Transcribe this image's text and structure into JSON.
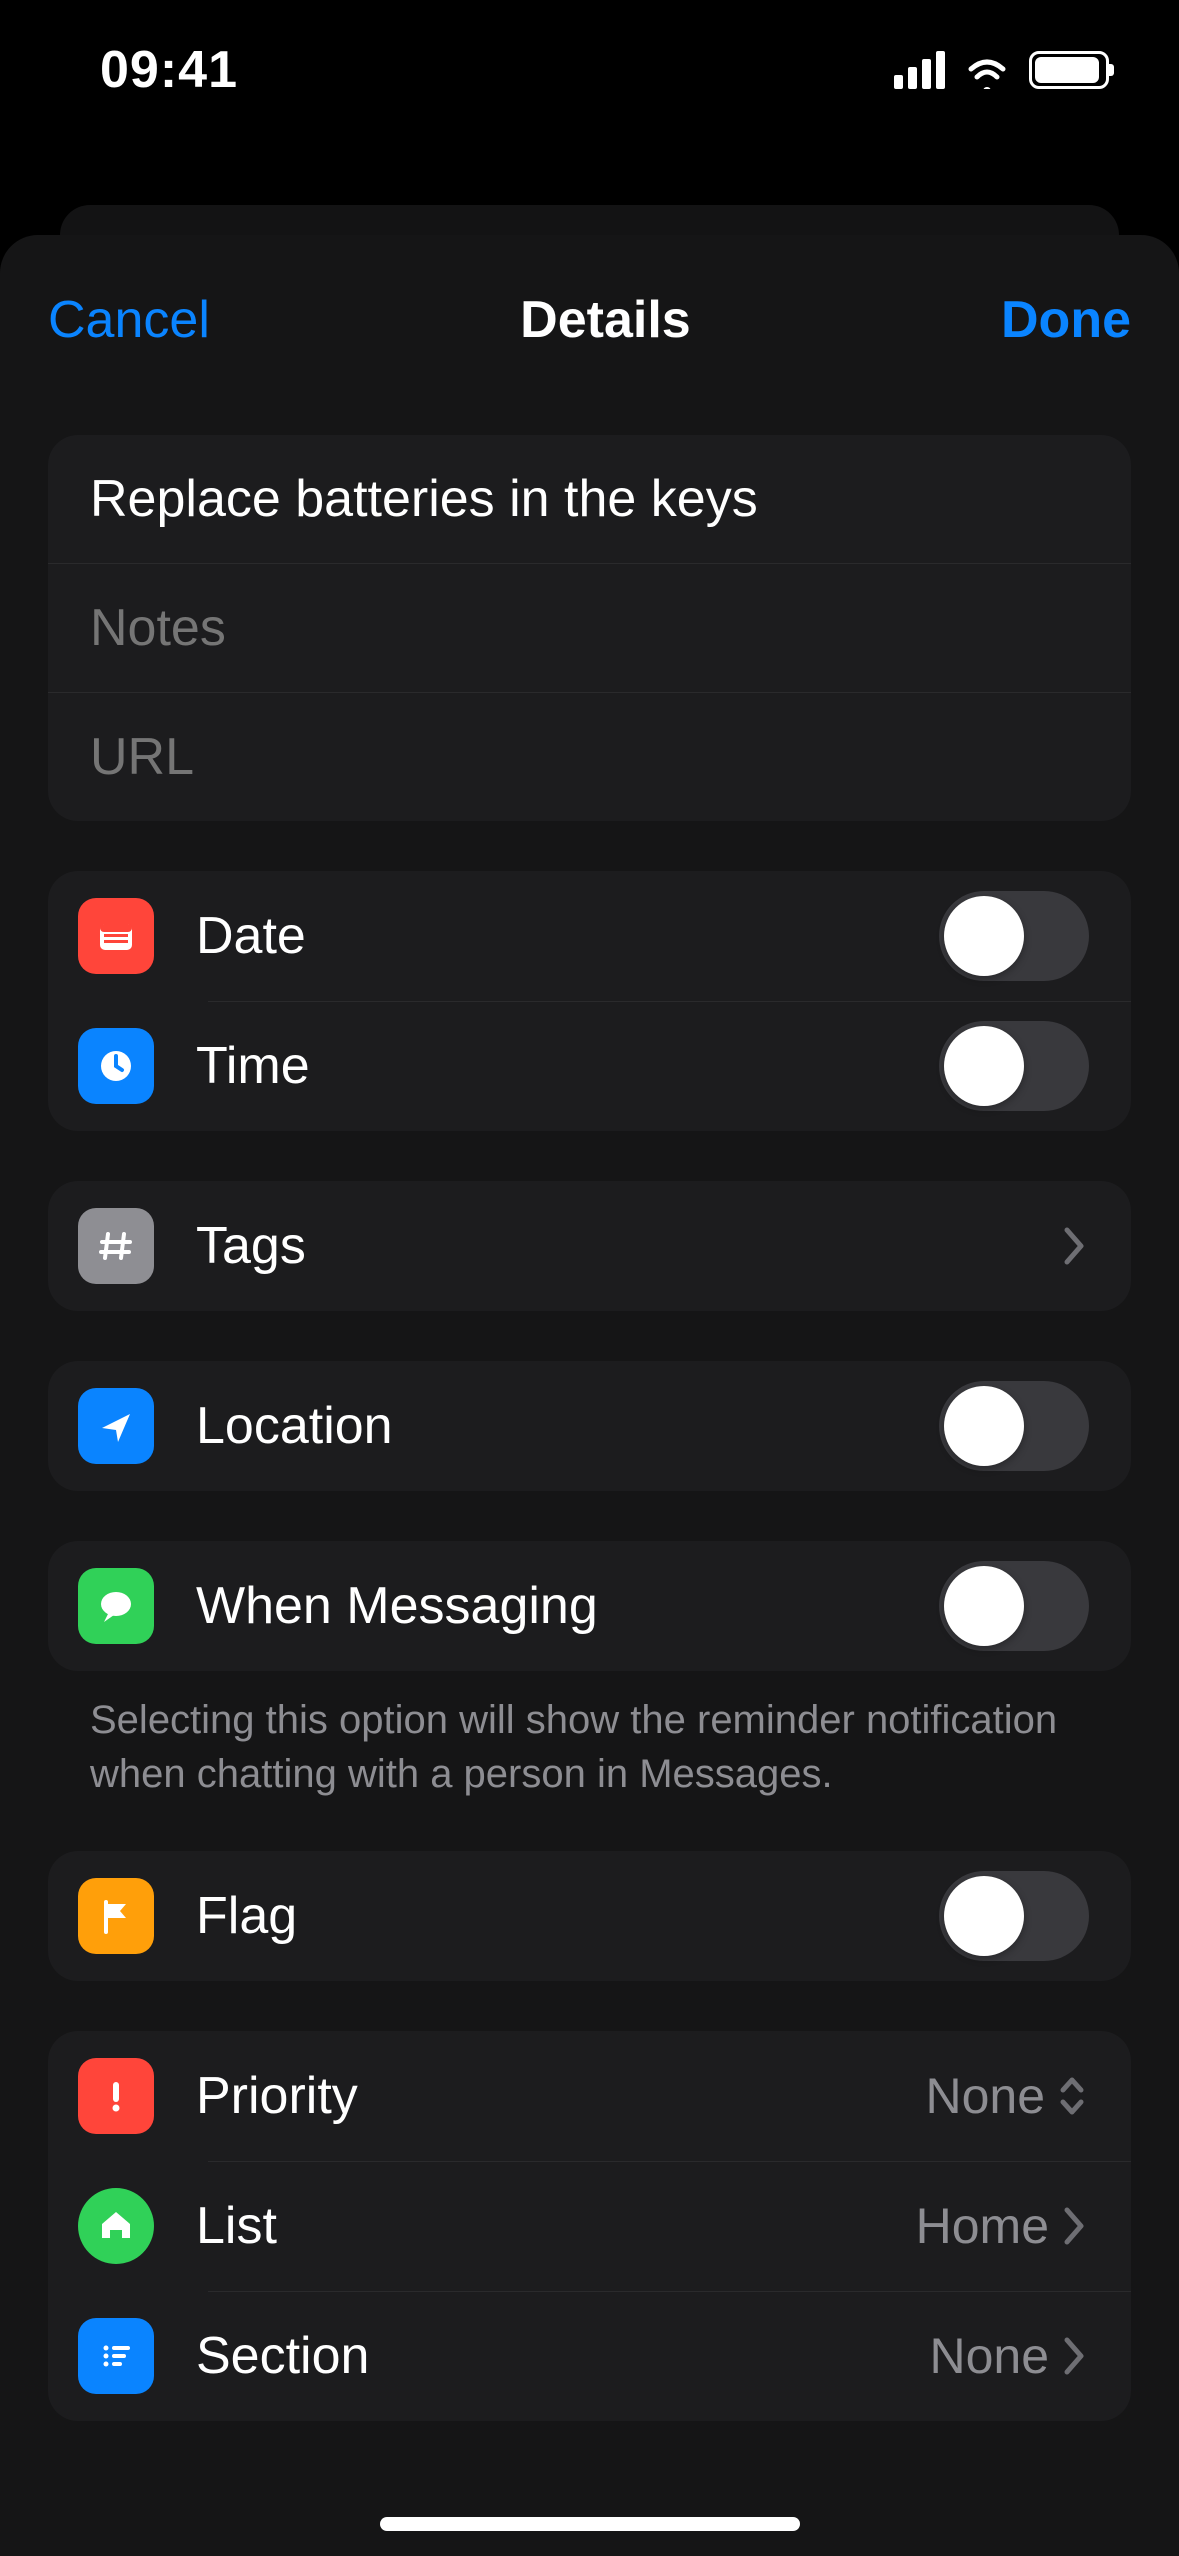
{
  "status": {
    "time": "09:41"
  },
  "nav": {
    "cancel": "Cancel",
    "title": "Details",
    "done": "Done"
  },
  "fields": {
    "title_value": "Replace batteries in the keys",
    "notes_placeholder": "Notes",
    "url_placeholder": "URL"
  },
  "rows": {
    "date": {
      "label": "Date",
      "on": false
    },
    "time": {
      "label": "Time",
      "on": false
    },
    "tags": {
      "label": "Tags"
    },
    "location": {
      "label": "Location",
      "on": false
    },
    "messaging": {
      "label": "When Messaging",
      "on": false,
      "footer": "Selecting this option will show the reminder notification when chatting with a person in Messages."
    },
    "flag": {
      "label": "Flag",
      "on": false
    },
    "priority": {
      "label": "Priority",
      "value": "None"
    },
    "list": {
      "label": "List",
      "value": "Home"
    },
    "section": {
      "label": "Section",
      "value": "None"
    }
  },
  "colors": {
    "accent": "#0a84ff",
    "grouped_bg": "#1c1c1e"
  }
}
